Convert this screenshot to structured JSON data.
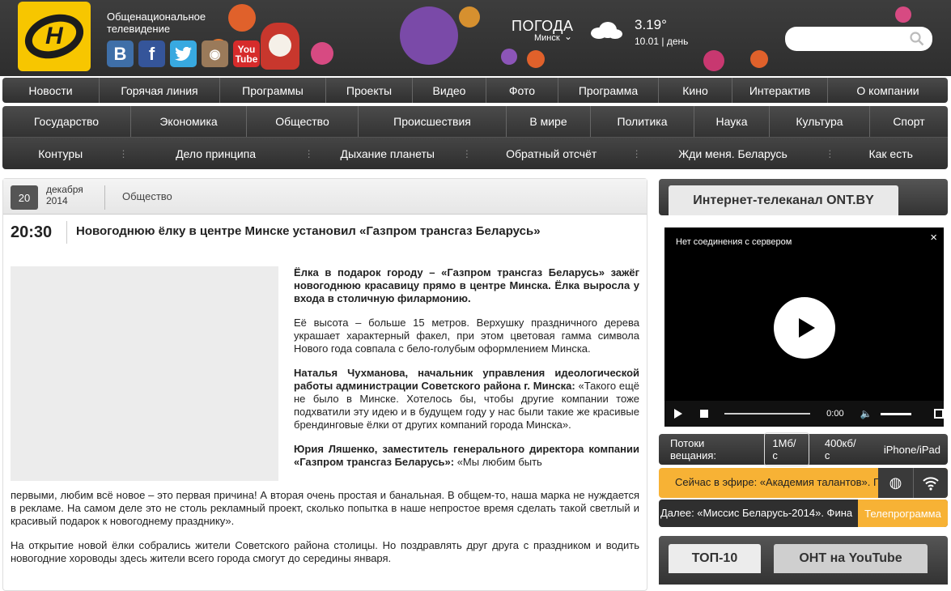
{
  "header": {
    "brand_line": "Общенациональное телевидение",
    "logo_letter": "Н",
    "socials": [
      {
        "name": "vkontakte",
        "glyph": "B"
      },
      {
        "name": "facebook",
        "glyph": "f"
      },
      {
        "name": "twitter",
        "glyph": "t"
      },
      {
        "name": "instagram",
        "glyph": "◉"
      },
      {
        "name": "youtube",
        "glyph": "You Tube"
      }
    ],
    "weather": {
      "title": "ПОГОДА",
      "city": "Минск",
      "temperature": "3.19°",
      "date_line": "10.01 | день",
      "icon": "cloud-icon"
    },
    "search": {
      "placeholder": "",
      "icon": "search-icon"
    }
  },
  "nav_main": [
    "Новости",
    "Горячая линия",
    "Программы",
    "Проекты",
    "Видео",
    "Фото",
    "Программа",
    "Кино",
    "Интерактив",
    "О компании"
  ],
  "nav_rubrics": [
    "Государство",
    "Экономика",
    "Общество",
    "Происшествия",
    "В мире",
    "Политика",
    "Наука",
    "Культура",
    "Спорт"
  ],
  "nav_shows": [
    "Контуры",
    "Дело принципа",
    "Дыхание планеты",
    "Обратный отсчёт",
    "Жди меня. Беларусь",
    "Как есть"
  ],
  "article": {
    "day": "20",
    "month": "декабря",
    "year": "2014",
    "rubric": "Общество",
    "time": "20:30",
    "title": "Новогоднюю ёлку в центре Минске установил «Газпром трансгаз Беларусь»",
    "lead": "Ёлка в подарок городу – «Газпром трансгаз Беларусь» зажёг новогоднюю красавицу прямо в центре Минска. Ёлка выросла у входа в столичную филармонию.",
    "p1": "Её высота – больше 15 метров. Верхушку праздничного дерева украшает характерный факел, при этом цветовая гамма символа Нового года совпала с бело-голубым оформлением Минска.",
    "p2_speaker": "Наталья Чухманова, начальник управления идеологической работы администрации Советского района г. Минска:",
    "p2_quote": " «Такого ещё не было в Минске. Хотелось бы, чтобы другие компании тоже подхватили эту идею и в будущем году у нас были такие же красивые брендинговые ёлки от других компаний города Минска».",
    "p3_speaker": "Юрия Ляшенко, заместитель генерального директора компании «Газпром трансгаз Беларусь»:",
    "p3_quote_a": " «Мы любим быть",
    "p3_quote_b": "первыми, любим всё новое – это первая причина! А вторая очень простая и банальная. В общем-то, наша марка не нуждается в рекламе. На самом деле это не столь рекламный проект, сколько попытка в наше непростое время сделать такой светлый и красивый подарок к новогоднему празднику».",
    "p4": "На открытие новой ёлки собрались жители Советского района столицы. Но поздравлять друг друга с праздником и водить новогодние хороводы здесь жители всего города смогут до середины января."
  },
  "sidebar": {
    "tv_tab": "Интернет-телеканал ONT.BY",
    "player": {
      "message": "Нет соединения с сервером",
      "close": "×",
      "time": "0:00"
    },
    "streams_label": "Потоки вещания:",
    "streams": [
      "1Мб/с",
      "400кб/с",
      "iPhone/iPad"
    ],
    "on_air": "Сейчас в эфире: «Академия талантов». Г",
    "next": "Далее: «Миссис Беларусь-2014». Фина",
    "program_button": "Телепрограмма",
    "bottom_tabs": [
      "ТОП-10",
      "ОНТ на YouTube"
    ]
  },
  "colors": {
    "accent": "#f7b235",
    "logo_yellow": "#f7c600",
    "dark": "#333333"
  }
}
